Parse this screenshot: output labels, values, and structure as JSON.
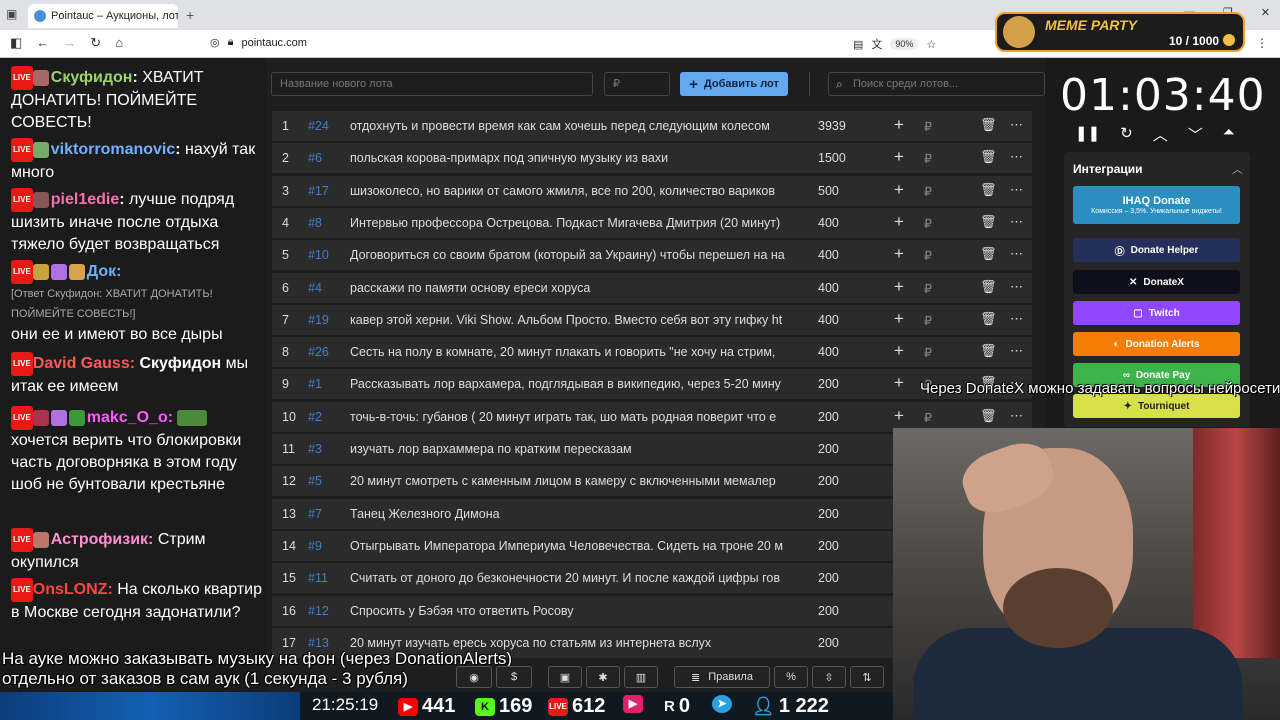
{
  "browser": {
    "tab_title": "Pointauc – Аукционы, лотереи",
    "url": "pointauc.com",
    "zoom": "90%"
  },
  "meme_party": {
    "title": "MEME PARTY",
    "count": "10 / 1000"
  },
  "chat": [
    {
      "user": "Скуфидон",
      "user_color": "#9fd36b",
      "text": " ХВАТИТ ДОНАТИТЬ! ПОЙМЕЙТЕ СОВЕСТЬ!"
    },
    {
      "user": "viktorromanovic",
      "user_color": "#6fb0ff",
      "text": " нахуй так много"
    },
    {
      "user": "piel1edie",
      "user_color": "#ff6fb0",
      "text": " лучше подряд шизить иначе после отдыха тяжело будет возвращаться"
    },
    {
      "user": "Док",
      "user_color": "#6fb0ff",
      "reply": "[Ответ Скуфидон: ХВАТИТ ДОНАТИТЬ! ПОЙМЕЙТЕ СОВЕСТЬ!]",
      "text": "они ее и имеют во все дыры"
    },
    {
      "user": "David Gauss",
      "user_color": "#ff5a5a",
      "text_bold": " Скуфидон",
      "text": " мы итак ее имеем"
    },
    {
      "user": "makc_O_o",
      "user_color": "#ff5aff",
      "text": " хочется верить что блокировки часть договорняка в этом году шоб не бунтовали крестьяне"
    },
    {
      "user": "Астрофизик",
      "user_color": "#ff8fd0",
      "text": " Стрим окупился"
    },
    {
      "user": "OnsLONZ",
      "user_color": "#ff4444",
      "text": " На сколько квартир в Москве сегодня задонатили?"
    }
  ],
  "controls": {
    "lot_placeholder": "Название нового лота",
    "amount_placeholder": "₽",
    "add_label": "Добавить лот",
    "search_placeholder": "Поиск среди лотов..."
  },
  "lots": [
    {
      "n": "1",
      "id": "#24",
      "title": "отдохнуть и провести время как сам хочешь перед следующим колесом",
      "amount": "3939"
    },
    {
      "n": "2",
      "id": "#6",
      "title": "польская корова-примарх под эпичную музыку из вахи",
      "amount": "1500"
    },
    {
      "n": "3",
      "id": "#17",
      "title": "шизоколесо, но варики от самого жмиля, все по 200, количество вариков",
      "amount": "500"
    },
    {
      "n": "4",
      "id": "#8",
      "title": "Интервью профессора Острецова. Подкаст Мигачева Дмитрия (20 минут)",
      "amount": "400"
    },
    {
      "n": "5",
      "id": "#10",
      "title": "Договориться со своим братом (который за Украину) чтобы перешел на на",
      "amount": "400"
    },
    {
      "n": "6",
      "id": "#4",
      "title": "расскажи по памяти основу ереси хоруса",
      "amount": "400"
    },
    {
      "n": "7",
      "id": "#19",
      "title": "кавер этой херни. Viki Show. Альбом Просто. Вместо себя вот эту гифку ht",
      "amount": "400"
    },
    {
      "n": "8",
      "id": "#26",
      "title": "Сесть на полу в комнате, 20 минут плакать и говорить \"не хочу на стрим,",
      "amount": "400"
    },
    {
      "n": "9",
      "id": "#1",
      "title": "Рассказывать лор вархамера, подглядывая в википедию, через 5-20 мину",
      "amount": "200"
    },
    {
      "n": "10",
      "id": "#2",
      "title": "точь-в-точь: губанов ( 20 минут играть так, шо мать родная поверит что е",
      "amount": "200"
    },
    {
      "n": "11",
      "id": "#3",
      "title": "изучать лор вархаммера по кратким пересказам",
      "amount": "200"
    },
    {
      "n": "12",
      "id": "#5",
      "title": "20 минут смотреть с каменным лицом в камеру с включенными мемалер",
      "amount": "200"
    },
    {
      "n": "13",
      "id": "#7",
      "title": "Танец Железного Димона",
      "amount": "200"
    },
    {
      "n": "14",
      "id": "#9",
      "title": "Отыгрывать Императора Империума Человечества. Сидеть на троне 20 м",
      "amount": "200"
    },
    {
      "n": "15",
      "id": "#11",
      "title": "Считать от доного до безконечности 20 минут. И после каждой цифры гов",
      "amount": "200"
    },
    {
      "n": "16",
      "id": "#12",
      "title": "Спросить у Бэбэя что ответить Росову",
      "amount": "200"
    },
    {
      "n": "17",
      "id": "#13",
      "title": "20 минут изучать ересь хоруса по статьям из интернета вслух",
      "amount": "200"
    }
  ],
  "currency_symbol": "₽",
  "timer": "01:03:40",
  "integrations": {
    "title": "Интеграции",
    "items": [
      {
        "label": "IHAQ Donate",
        "sub": "Комиссия – 3,5%. Уникальные виджеты!",
        "color": "#2a8fc0"
      },
      {
        "label": "Donate Helper",
        "color": "#24305a"
      },
      {
        "label": "DonateX",
        "color": "#0f0f1c"
      },
      {
        "label": "Twitch",
        "color": "#9146ff"
      },
      {
        "label": "Donation Alerts",
        "color": "#f57d07"
      },
      {
        "label": "Donate Pay",
        "color": "#3cb44a"
      },
      {
        "label": "Tourniquet",
        "color": "#d8e048"
      }
    ]
  },
  "overlay": {
    "donatex_line": "Через DonateX можно задавать вопросы нейросети",
    "music_line1": "На ауке можно заказывать музыку на фон (через DonationAlerts)",
    "music_line2": "отдельно от заказов в сам аук (1 секунда - 3 рубля)",
    "rules_label": "Правила"
  },
  "status": {
    "time": "21:25:19",
    "youtube": "441",
    "kick": "169",
    "vk_live": "612",
    "rutube": "",
    "r": "0",
    "viewers": "1 222"
  }
}
